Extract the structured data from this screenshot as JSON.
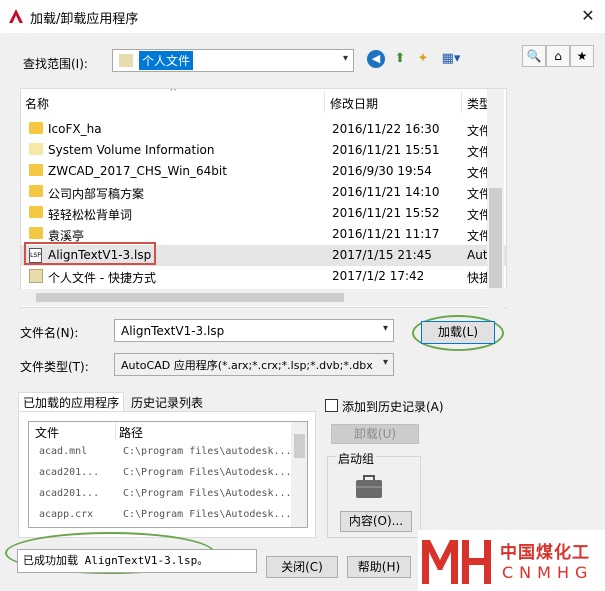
{
  "window": {
    "title": "加载/卸载应用程序",
    "close_glyph": "✕"
  },
  "lookin": {
    "label": "查找范围(I):",
    "value": "个人文件"
  },
  "columns": {
    "name": "名称",
    "modified": "修改日期",
    "type": "类型"
  },
  "files": [
    {
      "name": "IcoFX_ha",
      "date": "2016/11/22 16:30",
      "type": "文件",
      "icon": "folder-icon"
    },
    {
      "name": "System Volume Information",
      "date": "2016/11/21 15:51",
      "type": "文件",
      "icon": "folder-icon"
    },
    {
      "name": "ZWCAD_2017_CHS_Win_64bit",
      "date": "2016/9/30 19:54",
      "type": "文件",
      "icon": "folder-icon"
    },
    {
      "name": "公司内部写稿方案",
      "date": "2016/11/21 14:10",
      "type": "文件",
      "icon": "folder-icon"
    },
    {
      "name": "轻轻松松背单词",
      "date": "2016/11/21 15:52",
      "type": "文件",
      "icon": "folder-icon"
    },
    {
      "name": "袁溪亭",
      "date": "2016/11/21 11:17",
      "type": "文件",
      "icon": "folder-icon"
    },
    {
      "name": "AlignTextV1-3.lsp",
      "date": "2017/1/15 21:45",
      "type": "Auto",
      "icon": "lsp-file-icon"
    },
    {
      "name": "个人文件 - 快捷方式",
      "date": "2017/1/2 17:42",
      "type": "快捷",
      "icon": "shortcut-icon"
    }
  ],
  "filename": {
    "label": "文件名(N):",
    "value": "AlignTextV1-3.lsp"
  },
  "filetype": {
    "label": "文件类型(T):",
    "value": "AutoCAD 应用程序(*.arx;*.crx;*.lsp;*.dvb;*.dbx"
  },
  "buttons": {
    "load": "加载(L)",
    "unload": "卸载(U)",
    "contents": "内容(O)...",
    "close": "关闭(C)",
    "help": "帮助(H)"
  },
  "tabs": [
    "已加载的应用程序",
    "历史记录列表"
  ],
  "add_history": "添加到历史记录(A)",
  "app_columns": {
    "file": "文件",
    "path": "路径"
  },
  "apps": [
    {
      "file": "acad.mnl",
      "path": "C:\\program files\\autodesk..."
    },
    {
      "file": "acad201...",
      "path": "C:\\Program Files\\Autodesk..."
    },
    {
      "file": "acad201...",
      "path": "C:\\Program Files\\Autodesk..."
    },
    {
      "file": "acapp.crx",
      "path": "C:\\Program Files\\Autodesk..."
    }
  ],
  "startup_group": "启动组",
  "status": "已成功加载 AlignTextV1-3.lsp。",
  "watermark": {
    "cn": "中国煤化工",
    "en": "CNMHG",
    "color": "#d9322b"
  },
  "colors": {
    "highlight": "#0078d7",
    "selection_outline": "#d2504a",
    "annotation_green": "#6aa64a"
  }
}
